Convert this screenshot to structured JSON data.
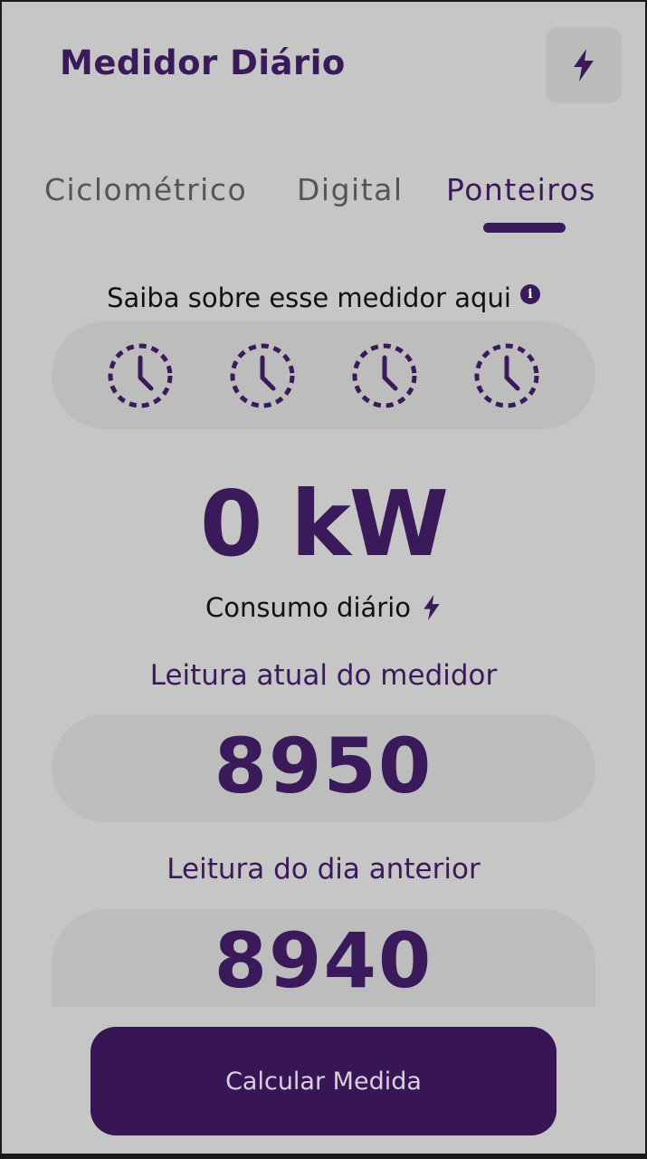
{
  "header": {
    "title": "Medidor Diário",
    "action_icon": "bolt-icon"
  },
  "tabs": [
    {
      "label": "Ciclométrico",
      "active": false
    },
    {
      "label": "Digital",
      "active": false
    },
    {
      "label": "Ponteiros",
      "active": true
    }
  ],
  "info": {
    "text": "Saiba sobre esse medidor aqui",
    "icon_glyph": "i"
  },
  "dials": {
    "count": 4,
    "icon": "clock-icon"
  },
  "consumption": {
    "value": "0 kW",
    "label": "Consumo diário",
    "icon": "bolt-icon"
  },
  "current_reading": {
    "label": "Leitura atual do medidor",
    "value": "8950"
  },
  "previous_reading": {
    "label": "Leitura do dia anterior",
    "value": "8940"
  },
  "actions": {
    "calculate_label": "Calcular Medida"
  },
  "colors": {
    "accent": "#3a1a5a",
    "button": "#381656",
    "background": "#c6c6c6",
    "panel": "#bdbdbd"
  }
}
